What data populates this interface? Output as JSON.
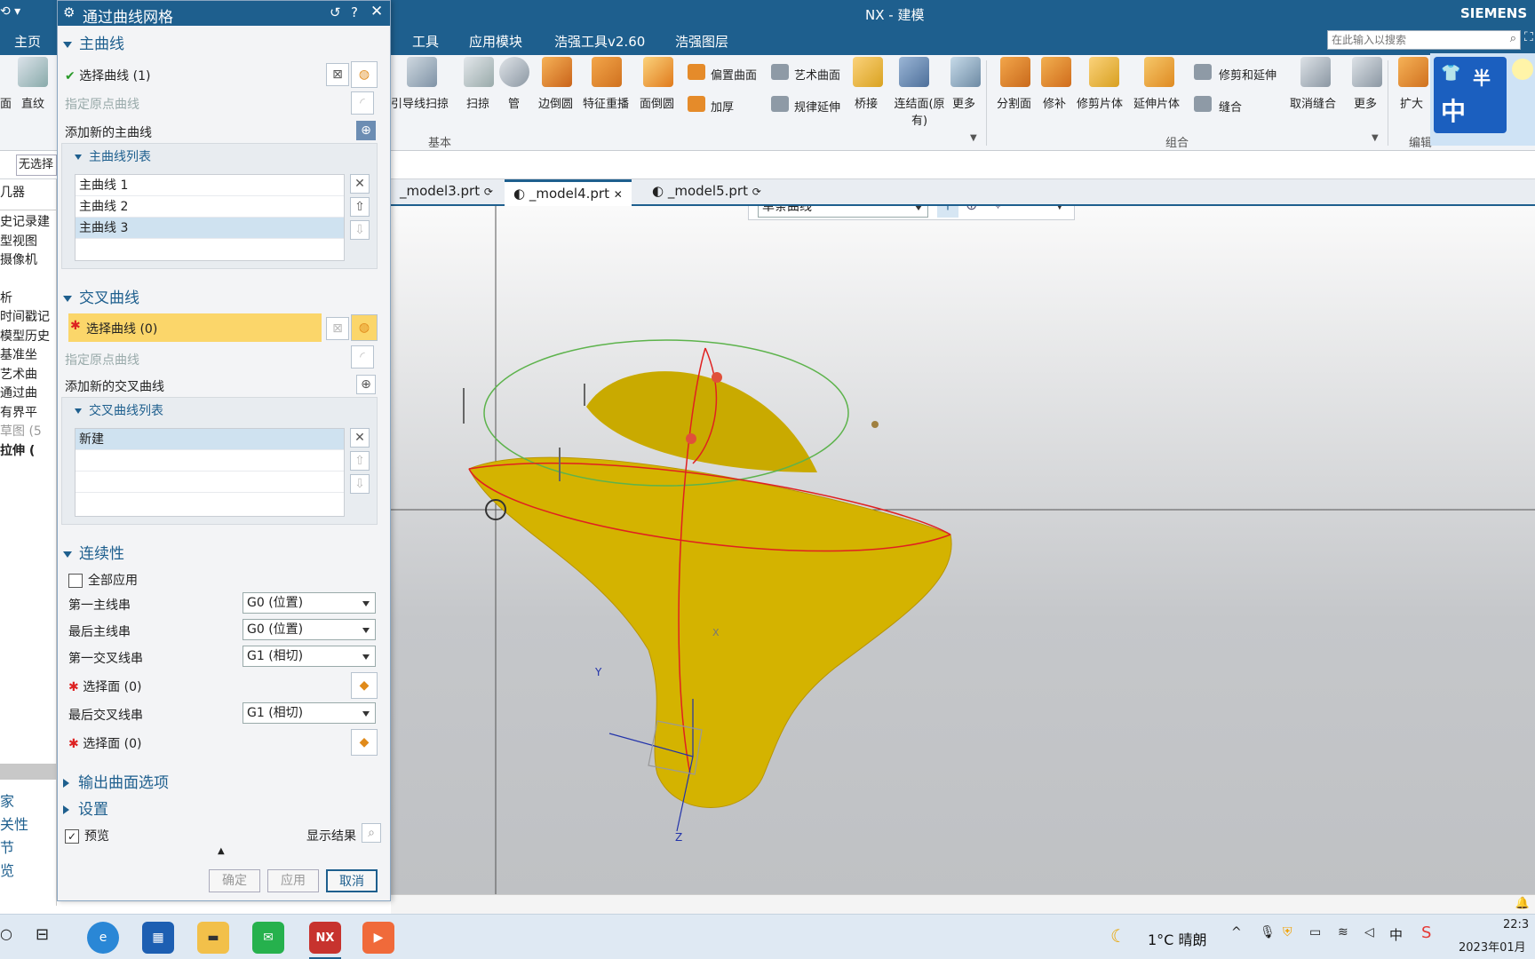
{
  "app": {
    "title": "NX - 建模",
    "brand": "SIEMENS"
  },
  "menu": {
    "home": "主页",
    "tools": "工具",
    "app_modules": "应用模块",
    "haoqiang_tools": "浩强工具v2.60",
    "haoqiang_layer": "浩强图层"
  },
  "search": {
    "placeholder": "在此输入以搜索"
  },
  "ribbon": {
    "items": [
      "引导线扫掠",
      "扫掠",
      "管",
      "边倒圆",
      "特征重播",
      "面倒圆",
      "偏置曲面",
      "艺术曲面",
      "加厚",
      "规律延伸",
      "桥接",
      "连结面(原有)",
      "更多",
      "分割面",
      "修补",
      "修剪片体",
      "延伸片体",
      "修剪和延伸",
      "缝合",
      "取消缝合",
      "更多",
      "扩大"
    ],
    "groups": {
      "basic": "基本",
      "combine": "组合",
      "edit": "编辑"
    },
    "left_items": {
      "a": "面",
      "b": "直纹"
    }
  },
  "nav": {
    "filter": "无选择",
    "header": "几器",
    "items": [
      "史记录建",
      "型视图",
      "摄像机",
      "析",
      "时间戳记",
      "模型历史",
      "基准坐",
      "艺术曲",
      "通过曲",
      "有界平",
      "草图 (5",
      "拉伸 ("
    ],
    "bottom": [
      "家",
      "关性",
      "节",
      "览"
    ]
  },
  "tabs": [
    {
      "label": "_model3.prt"
    },
    {
      "label": "_model4.prt"
    },
    {
      "label": "_model5.prt"
    }
  ],
  "viewport": {
    "filter": "单条曲线",
    "axes": {
      "x": "X",
      "y": "Y",
      "z": "Z"
    }
  },
  "dialog": {
    "title": "通过曲线网格",
    "primary": {
      "header": "主曲线",
      "select": "选择曲线 (1)",
      "origin": "指定原点曲线",
      "add": "添加新的主曲线",
      "list_header": "主曲线列表",
      "list": [
        "主曲线 1",
        "主曲线 2",
        "主曲线 3"
      ]
    },
    "cross": {
      "header": "交叉曲线",
      "select": "选择曲线 (0)",
      "origin": "指定原点曲线",
      "add": "添加新的交叉曲线",
      "list_header": "交叉曲线列表",
      "list": [
        "新建"
      ]
    },
    "continuity": {
      "header": "连续性",
      "apply_all": "全部应用",
      "first_primary": "第一主线串",
      "last_primary": "最后主线串",
      "first_cross": "第一交叉线串",
      "last_cross": "最后交叉线串",
      "select_face": "选择面 (0)",
      "g0": "G0 (位置)",
      "g1": "G1 (相切)"
    },
    "output": "输出曲面选项",
    "settings": "设置",
    "preview": "预览",
    "show_result": "显示结果",
    "ok": "确定",
    "apply": "应用",
    "cancel": "取消"
  },
  "taskbar": {
    "weather": "1°C 晴朗",
    "time": "22:3",
    "date": "2023年01月",
    "ime": "中",
    "nx": "NX"
  },
  "logo": {
    "text1": "半",
    "text2": "中"
  },
  "colors": {
    "accent": "#1e5f8e",
    "highlight": "#fbd66a",
    "surface": "#d7b400"
  }
}
